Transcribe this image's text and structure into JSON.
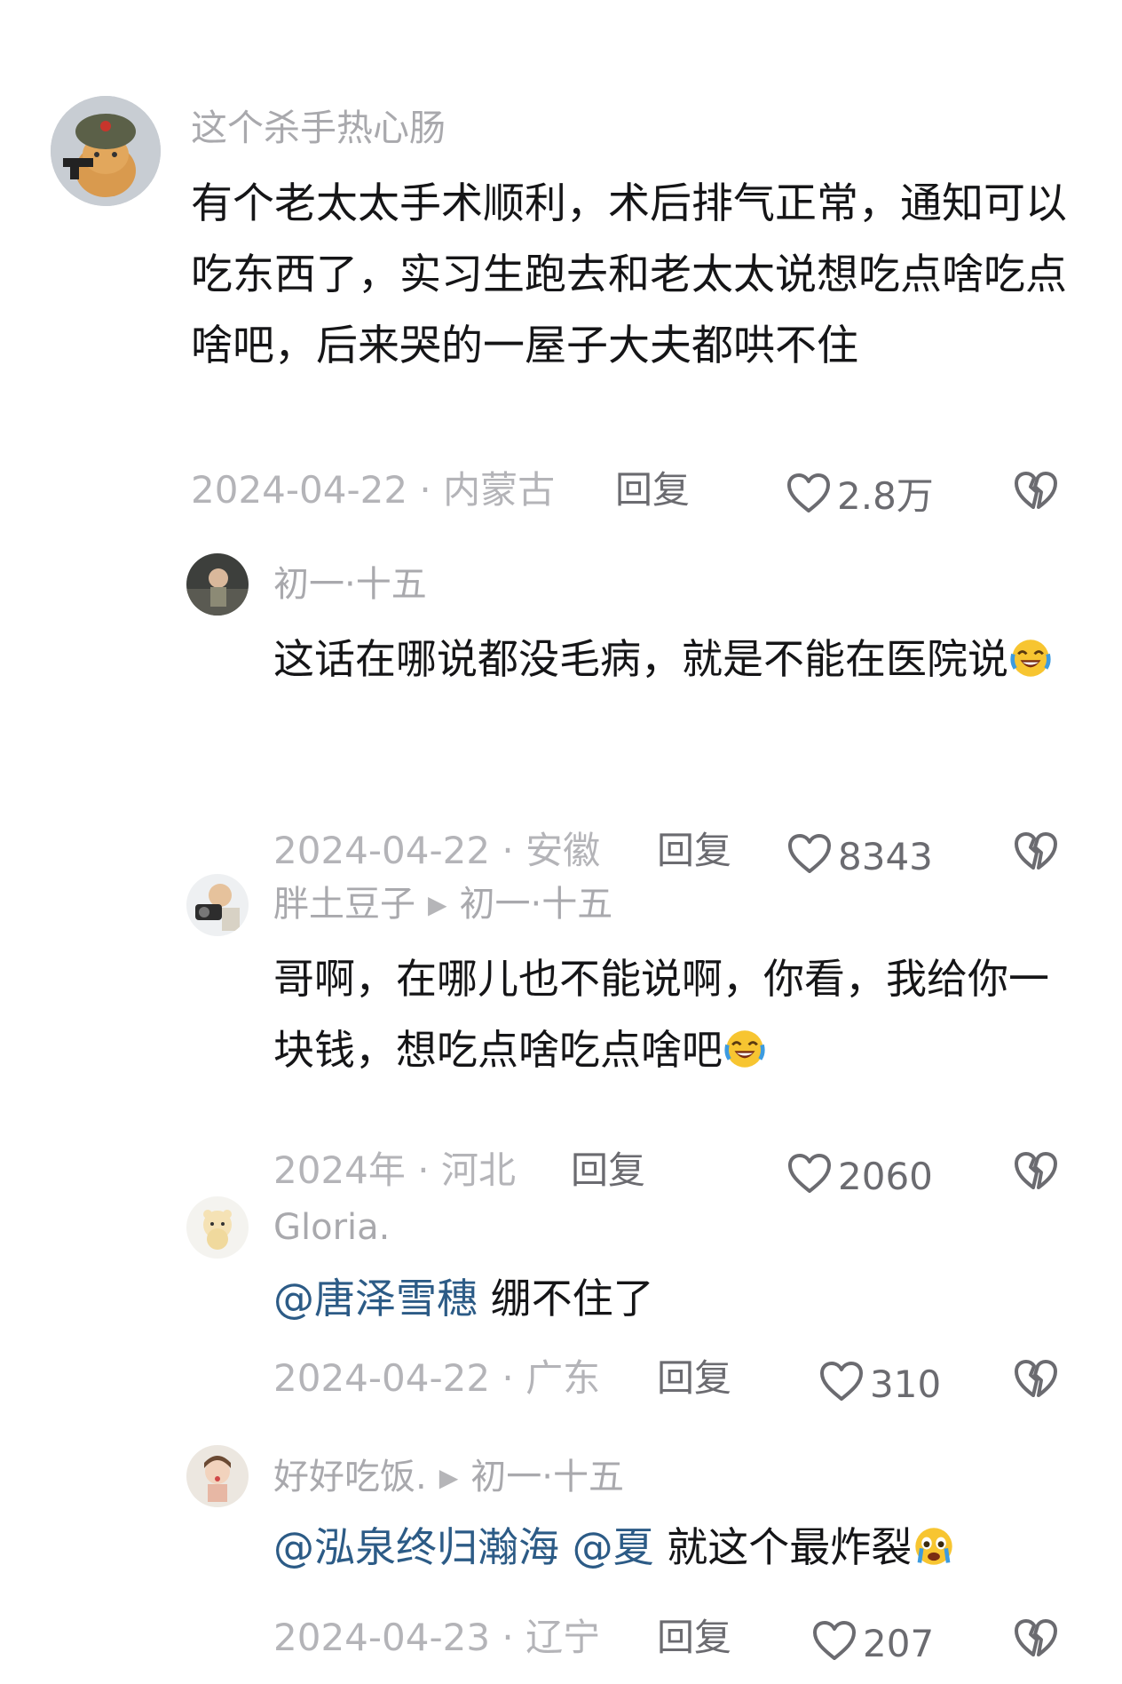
{
  "comments": [
    {
      "username": "这个杀手热心肠",
      "text": "有个老太太手术顺利，术后排气正常，通知可以吃东西了，实习生跑去和老太太说想吃点啥吃点啥吧，后来哭的一屋子大夫都哄不住",
      "date_location": "2024-04-22 · 内蒙古",
      "reply_label": "回复",
      "likes": "2.8万"
    },
    {
      "username": "初一·十五",
      "text": "这话在哪说都没毛病，就是不能在医院说",
      "emoji": "laughing-crying-emoji",
      "date_location": "2024-04-22 · 安徽",
      "reply_label": "回复",
      "likes": "8343"
    },
    {
      "username": "胖土豆子",
      "reply_to": "初一·十五",
      "text": "哥啊，在哪儿也不能说啊，你看，我给你一块钱，想吃点啥吃点啥吧",
      "emoji": "laughing-crying-emoji",
      "date_location": "2024年 · 河北",
      "reply_label": "回复",
      "likes": "2060"
    },
    {
      "username": "Gloria.",
      "mention": "@唐泽雪穗",
      "text": " 绷不住了",
      "date_location": "2024-04-22 · 广东",
      "reply_label": "回复",
      "likes": "310"
    },
    {
      "username": "好好吃饭.",
      "reply_to": "初一·十五",
      "mention": "@泓泉终归瀚海 @夏",
      "text": " 就这个最炸裂",
      "emoji": "crying-emoji",
      "date_location": "2024-04-23 · 辽宁",
      "reply_label": "回复",
      "likes": "207"
    }
  ],
  "icons": {
    "like": "heart-outline-icon",
    "dislike": "broken-heart-icon",
    "reply_arrow": "triangle-right-icon"
  },
  "colors": {
    "text": "#151517",
    "username": "#a9a9ad",
    "mention": "#2c5b86",
    "meta": "#b4b4b8",
    "action": "#6b6b70"
  }
}
